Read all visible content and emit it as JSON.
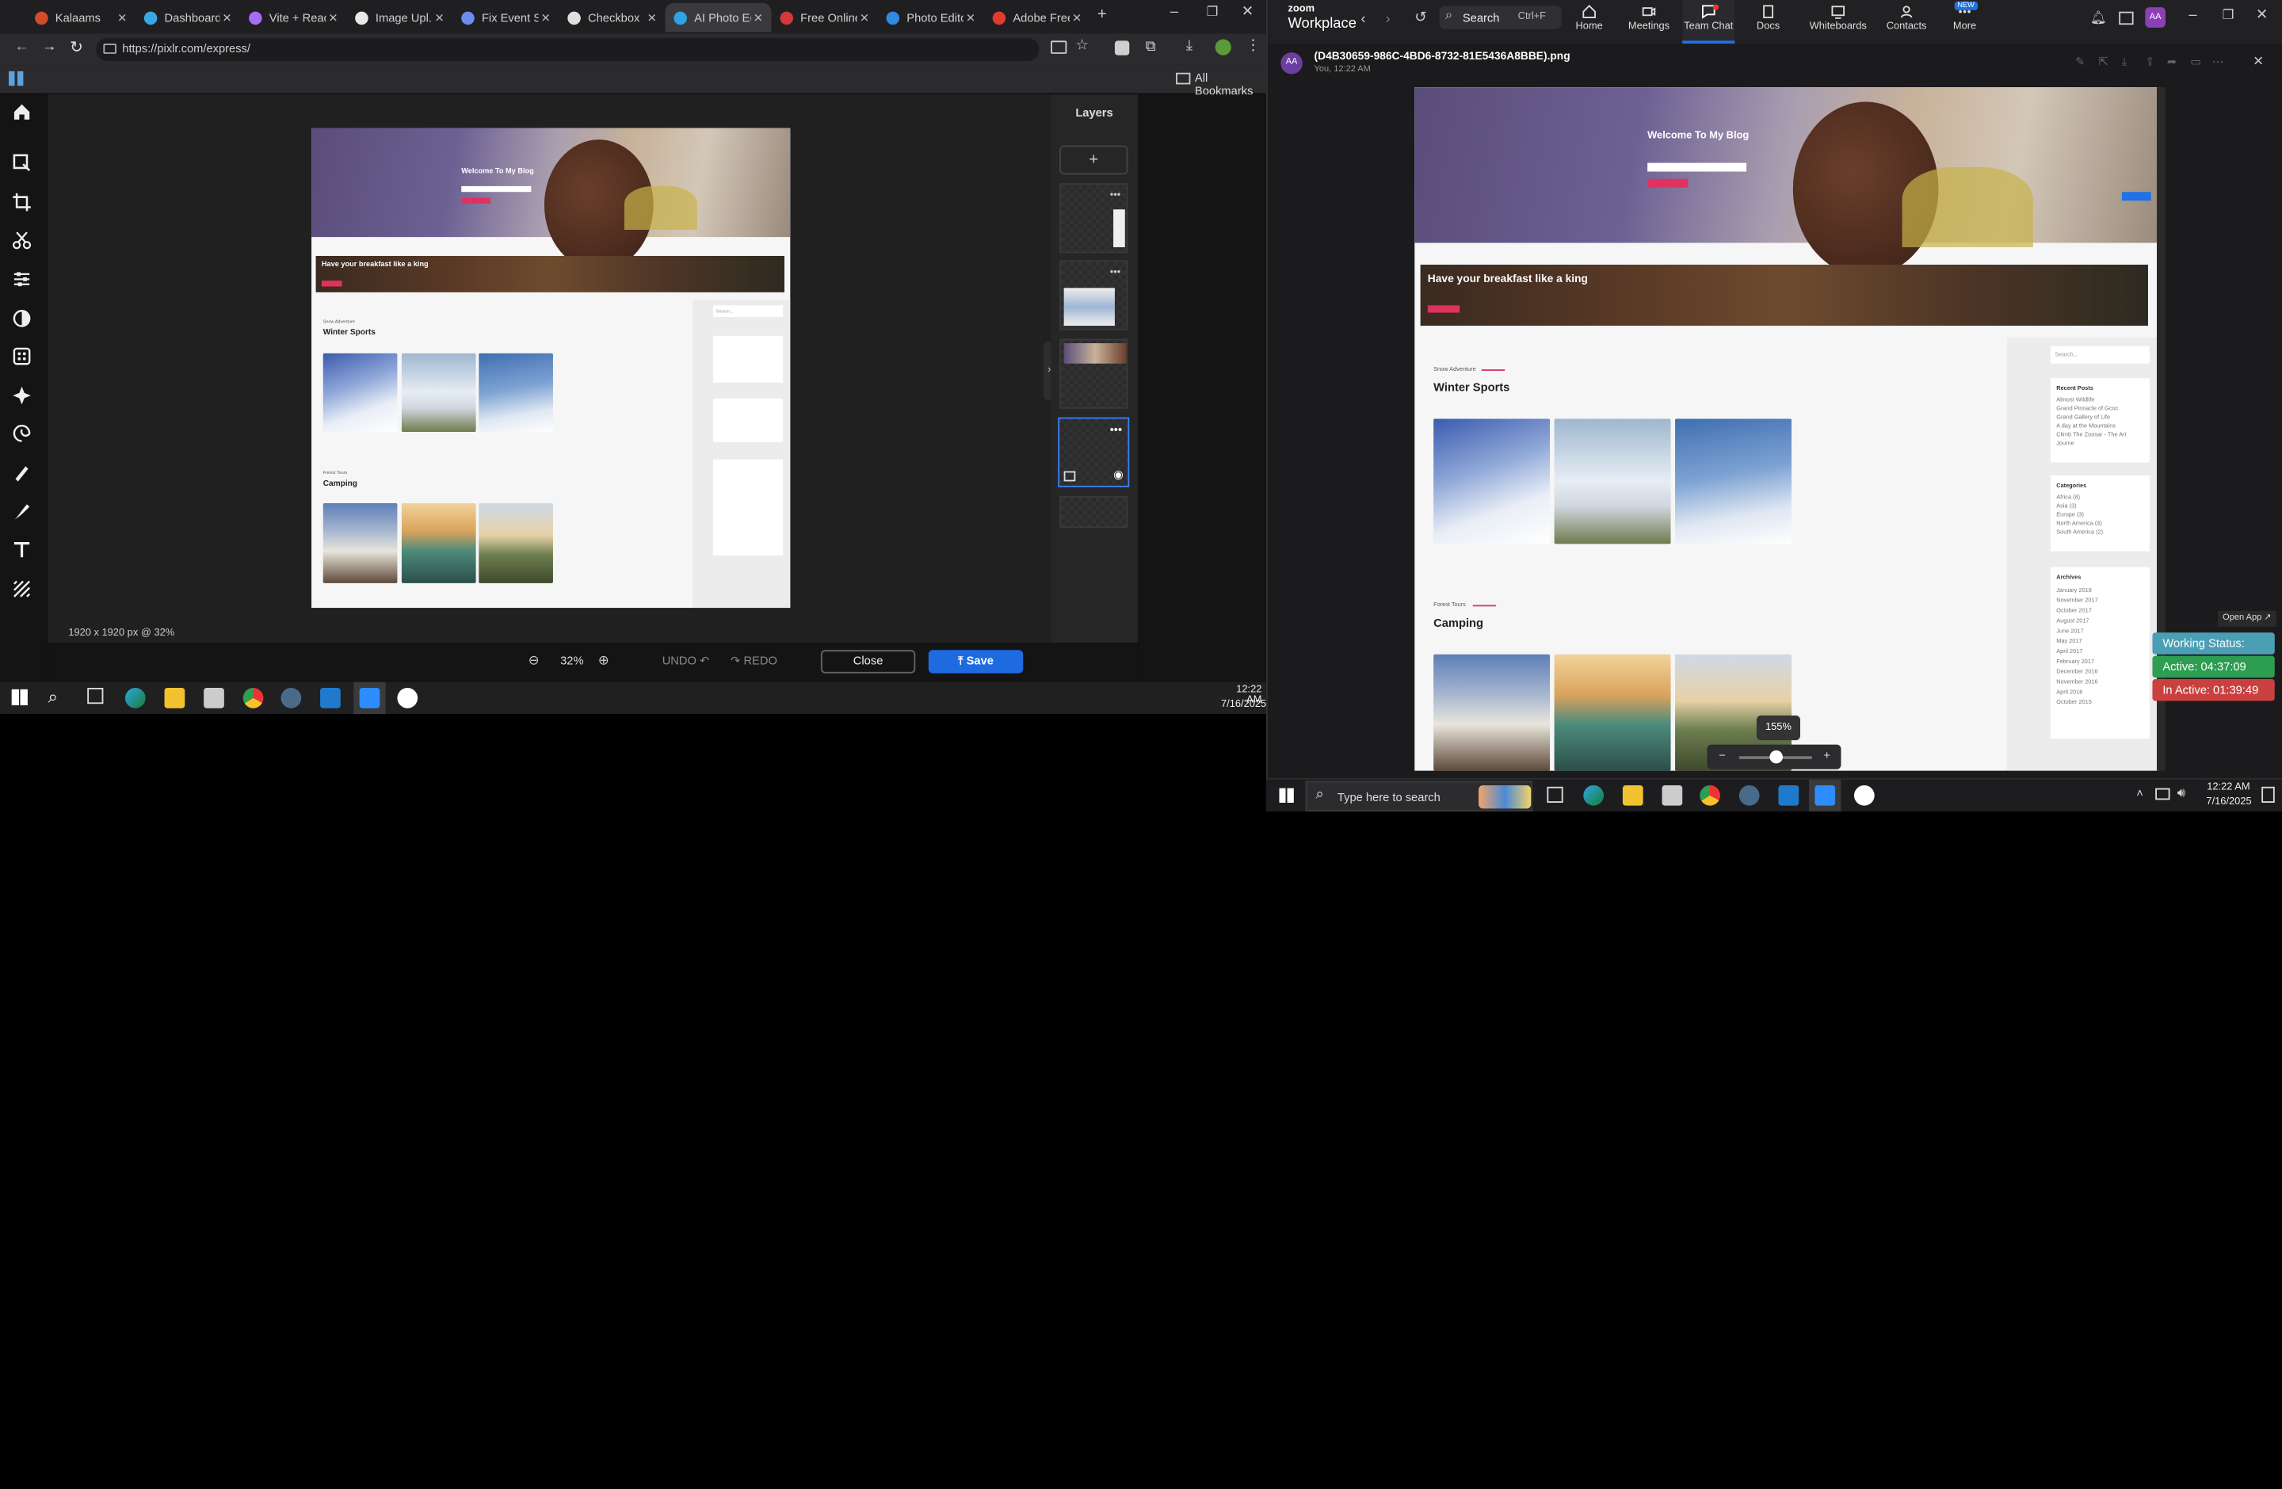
{
  "browser": {
    "tabs": [
      "Kalaams",
      "Dashboard",
      "Vite + React",
      "Image Upl...",
      "Fix Event Sc",
      "Checkbox",
      "AI Photo Ed",
      "Free Online",
      "Photo Edito",
      "Adobe Free"
    ],
    "url": "https://pixlr.com/express/",
    "bookmarks_label": "All Bookmarks"
  },
  "editor": {
    "layers_title": "Layers",
    "image_info": "1920 x 1920 px @ 32%",
    "zoom": "32%",
    "undo": "UNDO",
    "redo": "REDO",
    "close": "Close",
    "save": "Save"
  },
  "blog": {
    "hero_title": "Welcome To My Blog",
    "strip_title": "Have your breakfast like a king",
    "section1_kicker": "Snow Adventure",
    "section1_title": "Winter Sports",
    "section2_kicker": "Forest Tours",
    "section2_title": "Camping",
    "search_placeholder": "Search...",
    "recent_title": "Recent Posts",
    "recent_posts": [
      "Almost Wildlife",
      "Grand Pinnacle of Gcoc",
      "Grand Gallery of Life",
      "A day at the Mountains",
      "Climb The Zoosar - The Art Journe"
    ],
    "categories_title": "Categories",
    "categories": [
      "Africa (8)",
      "Asia (3)",
      "Europe (3)",
      "North America (4)",
      "South America (2)"
    ],
    "archives_title": "Archives",
    "archives": [
      "January 2018",
      "November 2017",
      "October 2017",
      "August 2017",
      "June 2017",
      "May 2017",
      "April 2017",
      "February 2017",
      "December 2016",
      "November 2016",
      "April 2016",
      "October 2015"
    ]
  },
  "zoom_app": {
    "brand_top": "zoom",
    "brand_bottom": "Workplace",
    "search": "Search",
    "search_shortcut": "Ctrl+F",
    "nav": [
      "Home",
      "Meetings",
      "Team Chat",
      "Docs",
      "Whiteboards",
      "Contacts",
      "More"
    ],
    "new_badge": "NEW",
    "avatar_initials": "AA",
    "file_name": "(D4B30659-986C-4BD6-8732-81E5436A8BBE).png",
    "sender_line": "You, 12:22 AM",
    "viewer_zoom": "155%",
    "open_app": "Open App",
    "status_working": "Working Status: Active",
    "status_active": "Active: 04:37:09",
    "status_inactive": "In Active: 01:39:49"
  },
  "taskbar_left": {
    "time": "12:22 AM",
    "date": "7/16/2025"
  },
  "taskbar_right": {
    "search_placeholder": "Type here to search",
    "time": "12:22 AM",
    "date": "7/16/2025"
  },
  "colors": {
    "save_blue": "#1e6be0",
    "zoom_active": "#1f72e6",
    "working": "#4a9fb5",
    "active": "#2d9d52",
    "inactive": "#c9403e"
  }
}
